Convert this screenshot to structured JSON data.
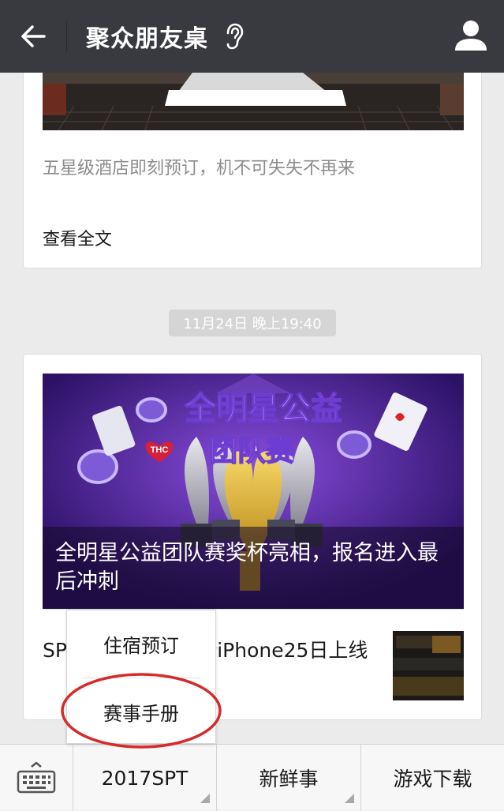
{
  "header": {
    "title": "聚众朋友桌",
    "back_icon": "back-arrow-icon",
    "listen_icon": "ear-icon",
    "profile_icon": "person-icon"
  },
  "card1": {
    "description": "五星级酒店即刻预订，机不可失失不再来",
    "read_more": "查看全文"
  },
  "timestamp": "11月24日 晚上19:40",
  "card2": {
    "cover_title": "全明星公益团队赛奖杯亮相，报名进入最后冲刺",
    "cover_art_text": [
      "全明星公益",
      "团队赛"
    ],
    "badge_text": "THC",
    "article_text": "SPT最后两天，全新iPhone25日上线"
  },
  "popup_menu": {
    "items": [
      "住宿预订",
      "赛事手册"
    ]
  },
  "bottom_bar": {
    "keyboard_icon": "keyboard-icon",
    "tabs": [
      "2017SPT",
      "新鲜事",
      "游戏下载"
    ]
  },
  "colors": {
    "topbar": "#393a3f",
    "background": "#ebebeb",
    "highlight_ring": "#d62b2b"
  }
}
